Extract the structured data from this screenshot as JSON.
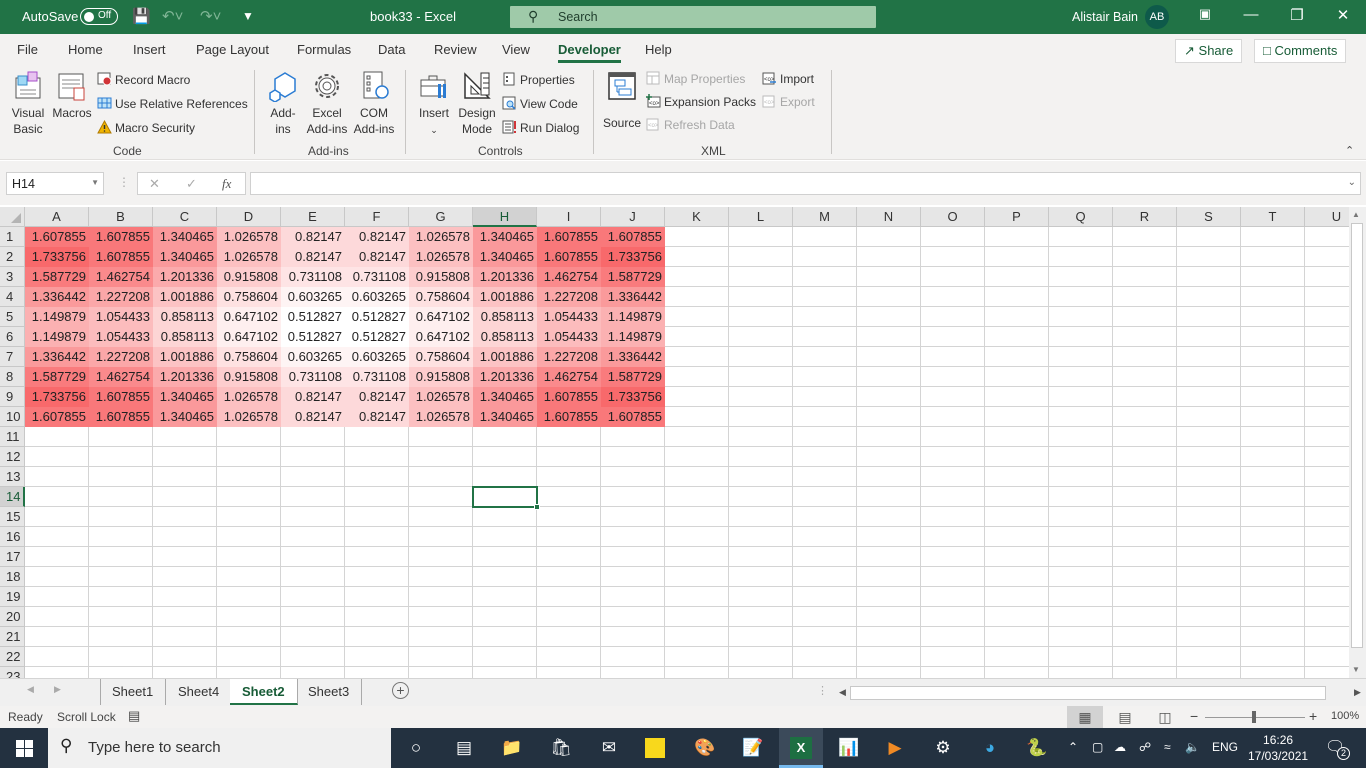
{
  "titlebar": {
    "autosave_label": "AutoSave",
    "autosave_state": "Off",
    "document_title": "book33  -  Excel",
    "search_placeholder": "Search",
    "user_name": "Alistair Bain",
    "user_initials": "AB"
  },
  "menu": {
    "tabs": [
      "File",
      "Home",
      "Insert",
      "Page Layout",
      "Formulas",
      "Data",
      "Review",
      "View",
      "Developer",
      "Help"
    ],
    "active_tab": "Developer",
    "share_label": "Share",
    "comments_label": "Comments"
  },
  "ribbon": {
    "code": {
      "group_label": "Code",
      "visual_basic": "Visual Basic",
      "visual_basic_l1": "Visual",
      "visual_basic_l2": "Basic",
      "macros": "Macros",
      "record_macro": "Record Macro",
      "use_relative": "Use Relative References",
      "macro_security": "Macro Security"
    },
    "addins": {
      "group_label": "Add-ins",
      "addins_l1": "Add-",
      "addins_l2": "ins",
      "excel_addins_l1": "Excel",
      "excel_addins_l2": "Add-ins",
      "com_addins_l1": "COM",
      "com_addins_l2": "Add-ins"
    },
    "controls": {
      "group_label": "Controls",
      "insert": "Insert",
      "design_l1": "Design",
      "design_l2": "Mode",
      "properties": "Properties",
      "view_code": "View Code",
      "run_dialog": "Run Dialog"
    },
    "xml": {
      "group_label": "XML",
      "source": "Source",
      "map_properties": "Map Properties",
      "expansion_packs": "Expansion Packs",
      "refresh_data": "Refresh Data",
      "import": "Import",
      "export": "Export"
    }
  },
  "formula_bar": {
    "name_box": "H14",
    "formula": "",
    "fx_label": "fx"
  },
  "grid": {
    "columns": [
      "A",
      "B",
      "C",
      "D",
      "E",
      "F",
      "G",
      "H",
      "I",
      "J",
      "K",
      "L",
      "M",
      "N",
      "O",
      "P",
      "Q",
      "R",
      "S",
      "T",
      "U"
    ],
    "rows": [
      "1",
      "2",
      "3",
      "4",
      "5",
      "6",
      "7",
      "8",
      "9",
      "10",
      "11",
      "12",
      "13",
      "14",
      "15",
      "16",
      "17",
      "18",
      "19",
      "20",
      "21",
      "22",
      "23"
    ],
    "selected_cell": "H14",
    "cells": [
      [
        "1.607855",
        "1.607855",
        "1.340465",
        "1.026578",
        "0.82147",
        "0.82147",
        "1.026578",
        "1.340465",
        "1.607855",
        "1.607855"
      ],
      [
        "1.733756",
        "1.607855",
        "1.340465",
        "1.026578",
        "0.82147",
        "0.82147",
        "1.026578",
        "1.340465",
        "1.607855",
        "1.733756"
      ],
      [
        "1.587729",
        "1.462754",
        "1.201336",
        "0.915808",
        "0.731108",
        "0.731108",
        "0.915808",
        "1.201336",
        "1.462754",
        "1.587729"
      ],
      [
        "1.336442",
        "1.227208",
        "1.001886",
        "0.758604",
        "0.603265",
        "0.603265",
        "0.758604",
        "1.001886",
        "1.227208",
        "1.336442"
      ],
      [
        "1.149879",
        "1.054433",
        "0.858113",
        "0.647102",
        "0.512827",
        "0.512827",
        "0.647102",
        "0.858113",
        "1.054433",
        "1.149879"
      ],
      [
        "1.149879",
        "1.054433",
        "0.858113",
        "0.647102",
        "0.512827",
        "0.512827",
        "0.647102",
        "0.858113",
        "1.054433",
        "1.149879"
      ],
      [
        "1.336442",
        "1.227208",
        "1.001886",
        "0.758604",
        "0.603265",
        "0.603265",
        "0.758604",
        "1.001886",
        "1.227208",
        "1.336442"
      ],
      [
        "1.587729",
        "1.462754",
        "1.201336",
        "0.915808",
        "0.731108",
        "0.731108",
        "0.915808",
        "1.201336",
        "1.462754",
        "1.587729"
      ],
      [
        "1.733756",
        "1.607855",
        "1.340465",
        "1.026578",
        "0.82147",
        "0.82147",
        "1.026578",
        "1.340465",
        "1.607855",
        "1.733756"
      ],
      [
        "1.607855",
        "1.607855",
        "1.340465",
        "1.026578",
        "0.82147",
        "0.82147",
        "1.026578",
        "1.340465",
        "1.607855",
        "1.607855"
      ]
    ],
    "color_scale": {
      "min_color": "#ffffff",
      "max_color": "#f8696b"
    }
  },
  "sheets": {
    "tabs": [
      "Sheet1",
      "Sheet4",
      "Sheet2",
      "Sheet3"
    ],
    "active": "Sheet2"
  },
  "status": {
    "ready": "Ready",
    "scroll_lock": "Scroll Lock",
    "zoom": "100%",
    "zoom_minus": "−",
    "zoom_plus": "+"
  },
  "taskbar": {
    "search_placeholder": "Type here to search",
    "language": "ENG",
    "time": "16:26",
    "date": "17/03/2021",
    "notification_count": "2"
  }
}
